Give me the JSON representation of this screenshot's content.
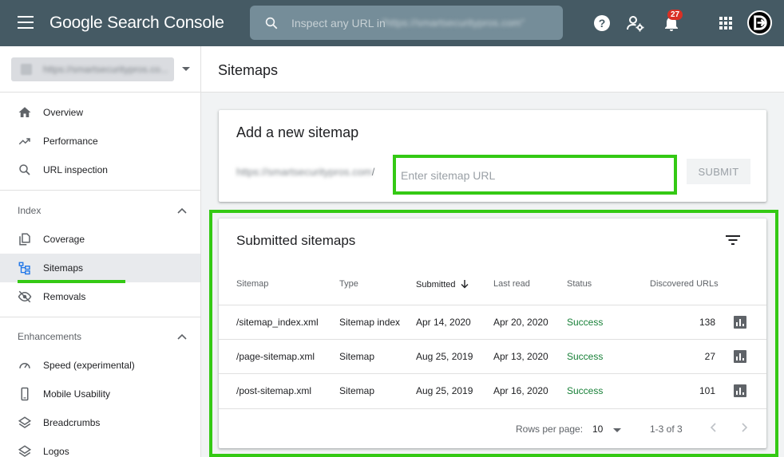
{
  "topbar": {
    "brand": "Google Search Console",
    "search_placeholder": "Inspect any URL in",
    "search_url_blurred": "\"https://smartsecuritypros.com\"",
    "notifications_count": "27"
  },
  "sidebar": {
    "property_blurred": "https://smartsecuritypros.co...",
    "items_top": [
      {
        "label": "Overview",
        "icon": "home-icon"
      },
      {
        "label": "Performance",
        "icon": "trending-up-icon"
      },
      {
        "label": "URL inspection",
        "icon": "search-icon"
      }
    ],
    "index_section": "Index",
    "items_index": [
      {
        "label": "Coverage",
        "icon": "copy-icon"
      },
      {
        "label": "Sitemaps",
        "icon": "sitemap-icon",
        "active": true
      },
      {
        "label": "Removals",
        "icon": "visibility-off-icon"
      }
    ],
    "enhancements_section": "Enhancements",
    "items_enh": [
      {
        "label": "Speed (experimental)",
        "icon": "speed-icon"
      },
      {
        "label": "Mobile Usability",
        "icon": "phone-icon"
      },
      {
        "label": "Breadcrumbs",
        "icon": "layers-icon"
      },
      {
        "label": "Logos",
        "icon": "layers-icon"
      }
    ]
  },
  "main": {
    "page_title": "Sitemaps",
    "add": {
      "title": "Add a new sitemap",
      "base_url": "https://smartsecuritypros.com",
      "slash": "/",
      "input_placeholder": "Enter sitemap URL",
      "submit_label": "SUBMIT"
    },
    "submitted": {
      "title": "Submitted sitemaps",
      "headers": {
        "sitemap": "Sitemap",
        "type": "Type",
        "submitted": "Submitted",
        "last_read": "Last read",
        "status": "Status",
        "discovered": "Discovered URLs"
      },
      "rows": [
        {
          "sitemap": "/sitemap_index.xml",
          "type": "Sitemap index",
          "submitted": "Apr 14, 2020",
          "last_read": "Apr 20, 2020",
          "status": "Success",
          "discovered": "138"
        },
        {
          "sitemap": "/page-sitemap.xml",
          "type": "Sitemap",
          "submitted": "Aug 25, 2019",
          "last_read": "Apr 13, 2020",
          "status": "Success",
          "discovered": "27"
        },
        {
          "sitemap": "/post-sitemap.xml",
          "type": "Sitemap",
          "submitted": "Aug 25, 2019",
          "last_read": "Apr 16, 2020",
          "status": "Success",
          "discovered": "101"
        }
      ],
      "rows_per_page_label": "Rows per page:",
      "rows_per_page_value": "10",
      "range": "1-3 of 3"
    }
  },
  "colors": {
    "topbar": "#455a64",
    "highlight": "#34c914",
    "success": "#188038"
  }
}
